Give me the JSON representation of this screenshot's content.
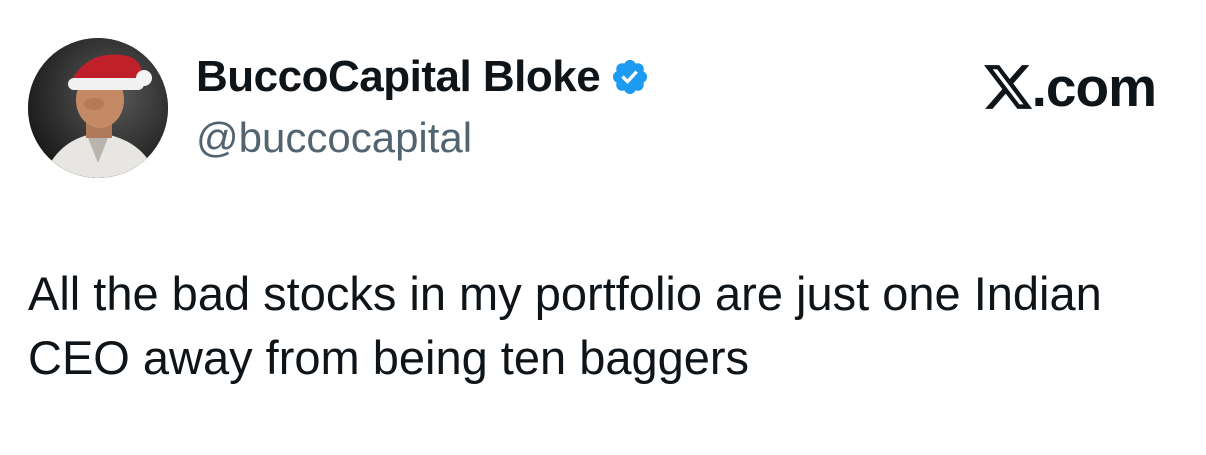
{
  "author": {
    "display_name": "BuccoCapital Bloke",
    "handle": "@buccocapital",
    "verified": true,
    "avatar_icon": "avatar-santa-hat"
  },
  "platform": {
    "icon": "x-logo-icon",
    "domain": ".com"
  },
  "tweet": {
    "text": "All the bad stocks in my portfolio are just one Indian CEO away from being ten baggers"
  },
  "colors": {
    "text": "#0f1419",
    "handle": "#536471",
    "verified_badge": "#1d9bf0",
    "background": "#ffffff"
  }
}
